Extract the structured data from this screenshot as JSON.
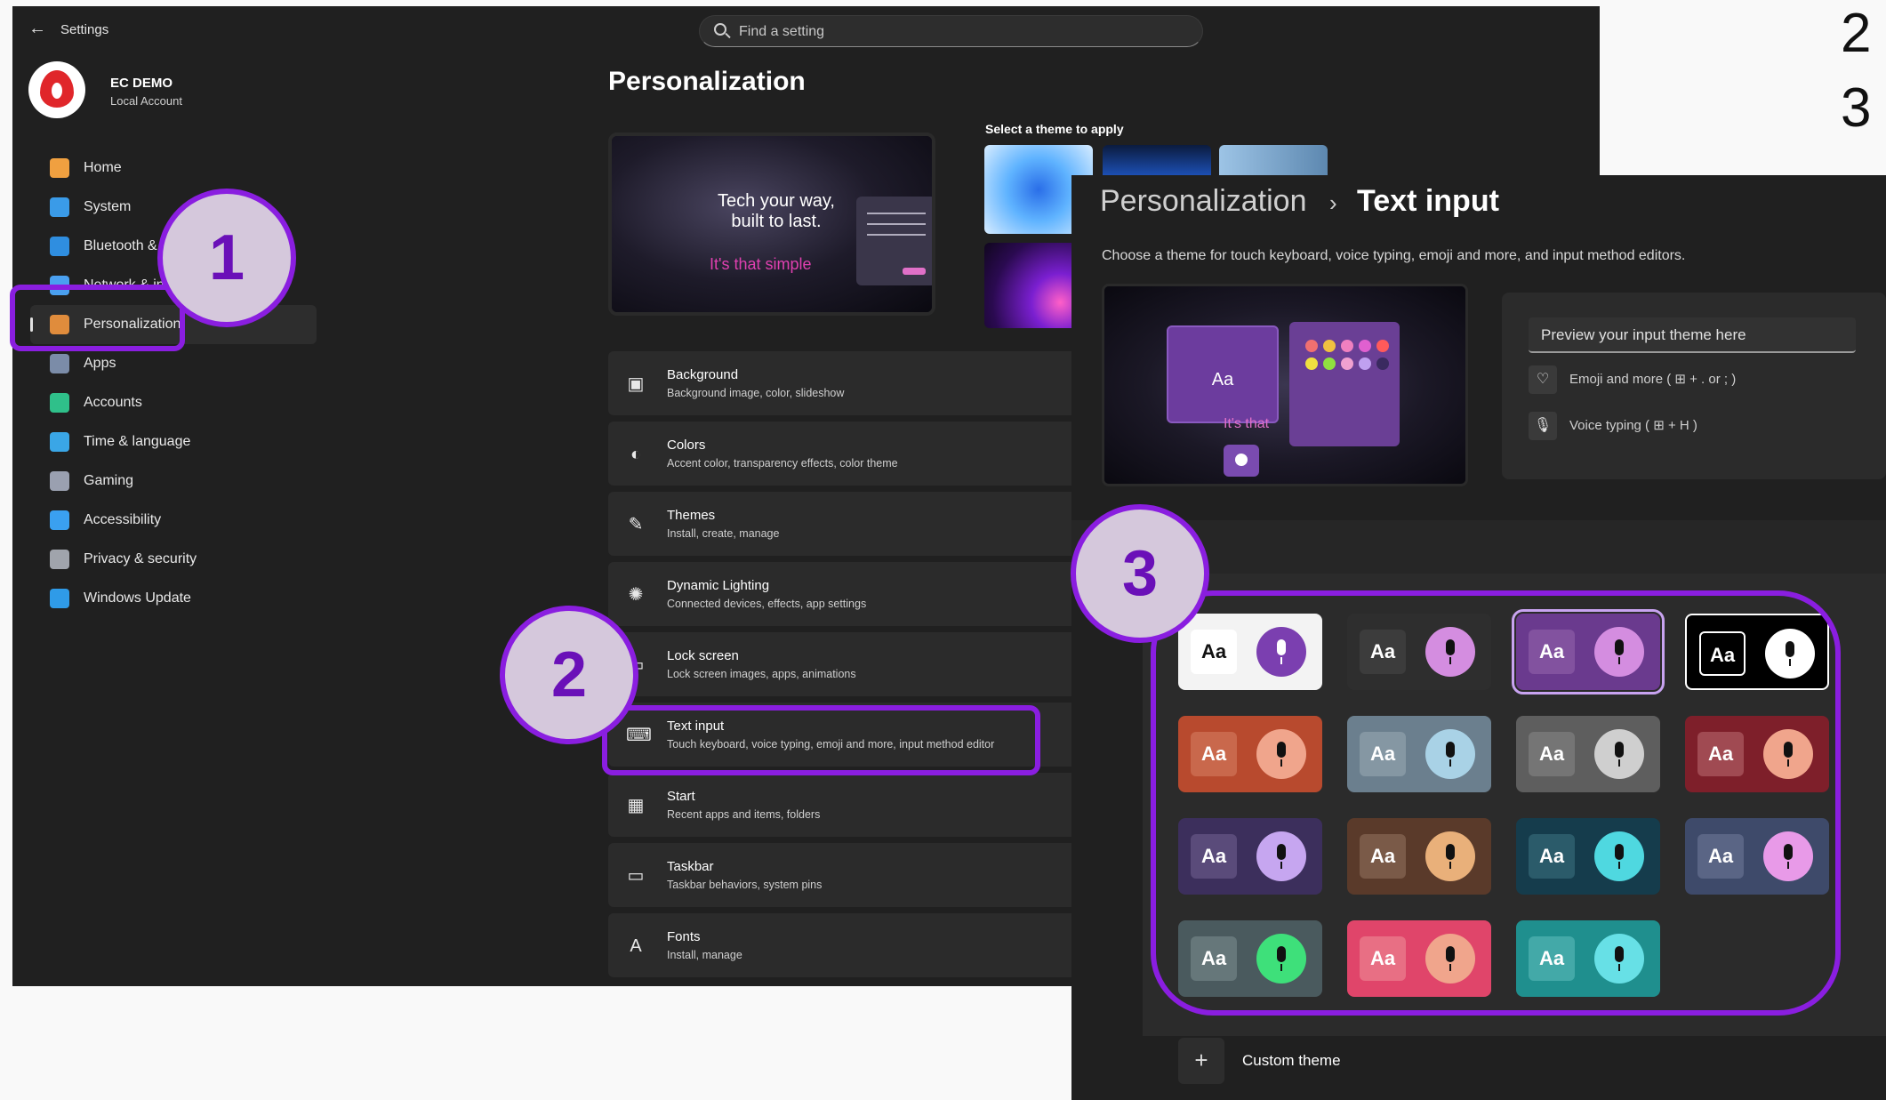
{
  "settings": {
    "app_title": "Settings",
    "search_placeholder": "Find a setting",
    "profile": {
      "name": "EC DEMO",
      "account_type": "Local Account"
    },
    "nav": [
      {
        "label": "Home",
        "icon": "home-icon",
        "color": "#f0a040",
        "active": false
      },
      {
        "label": "System",
        "icon": "system-icon",
        "color": "#3a9be8",
        "active": false
      },
      {
        "label": "Bluetooth & d",
        "icon": "bluetooth-icon",
        "color": "#2f8ee0",
        "active": false
      },
      {
        "label": "Network & int",
        "icon": "network-icon",
        "color": "#4aa0f0",
        "active": false
      },
      {
        "label": "Personalization",
        "icon": "brush-icon",
        "color": "#e08c3c",
        "active": true
      },
      {
        "label": "Apps",
        "icon": "apps-icon",
        "color": "#7b8ca8",
        "active": false
      },
      {
        "label": "Accounts",
        "icon": "accounts-icon",
        "color": "#2fc08a",
        "active": false
      },
      {
        "label": "Time & language",
        "icon": "globe-icon",
        "color": "#3aa6e6",
        "active": false
      },
      {
        "label": "Gaming",
        "icon": "gamepad-icon",
        "color": "#9aa0b0",
        "active": false
      },
      {
        "label": "Accessibility",
        "icon": "accessibility-icon",
        "color": "#3aa0f0",
        "active": false
      },
      {
        "label": "Privacy & security",
        "icon": "shield-icon",
        "color": "#a0a4ac",
        "active": false
      },
      {
        "label": "Windows Update",
        "icon": "update-icon",
        "color": "#2f9be8",
        "active": false
      }
    ],
    "page_title": "Personalization",
    "hero": {
      "line1": "Tech your way, built to last.",
      "line2": "It's that simple"
    },
    "themes_heading": "Select a theme to apply",
    "cards": [
      {
        "title": "Background",
        "subtitle": "Background image, color, slideshow",
        "icon": "image-icon",
        "glyph": "▣"
      },
      {
        "title": "Colors",
        "subtitle": "Accent color, transparency effects, color theme",
        "icon": "palette-icon",
        "glyph": "◐"
      },
      {
        "title": "Themes",
        "subtitle": "Install, create, manage",
        "icon": "brush-icon",
        "glyph": "✎"
      },
      {
        "title": "Dynamic Lighting",
        "subtitle": "Connected devices, effects, app settings",
        "icon": "lighting-icon",
        "glyph": "✺"
      },
      {
        "title": "Lock screen",
        "subtitle": "Lock screen images, apps, animations",
        "icon": "lock-screen-icon",
        "glyph": "▭"
      },
      {
        "title": "Text input",
        "subtitle": "Touch keyboard, voice typing, emoji and more, input method editor",
        "icon": "keyboard-icon",
        "glyph": "⌨"
      },
      {
        "title": "Start",
        "subtitle": "Recent apps and items, folders",
        "icon": "start-icon",
        "glyph": "▦"
      },
      {
        "title": "Taskbar",
        "subtitle": "Taskbar behaviors, system pins",
        "icon": "taskbar-icon",
        "glyph": "▭"
      },
      {
        "title": "Fonts",
        "subtitle": "Install, manage",
        "icon": "fonts-icon",
        "glyph": "A"
      }
    ]
  },
  "text_input": {
    "breadcrumb_parent": "Personalization",
    "breadcrumb_sep": "›",
    "breadcrumb_current": "Text input",
    "description": "Choose a theme for touch keyboard, voice typing, emoji and more, and input method editors.",
    "preview_input_placeholder": "Preview your input theme here",
    "preview_rows": [
      {
        "label": "Emoji and more ( ⊞ + . or ; )",
        "icon": "emoji-icon",
        "glyph": "♡"
      },
      {
        "label": "Voice typing ( ⊞ + H )",
        "icon": "microphone-icon",
        "glyph": "🎙"
      }
    ],
    "preview_text": "It's that",
    "preview_key": "Aa",
    "tile_label": "Aa",
    "themes": [
      {
        "name": "light",
        "bg": "#f3f3f3",
        "aa_bg": "#ffffff",
        "aa_fg": "#111111",
        "mic": "#7b3fb0",
        "mic_light": true,
        "selected": false
      },
      {
        "name": "dark",
        "bg": "#2e2e2e",
        "aa_bg": "#3c3c3c",
        "aa_fg": "#ffffff",
        "mic": "#d48de0",
        "mic_light": false,
        "selected": false
      },
      {
        "name": "purple",
        "bg": "#6a3a8e",
        "aa_bg": "#82529f",
        "aa_fg": "#ffffff",
        "mic": "#d48de0",
        "mic_light": false,
        "selected": true
      },
      {
        "name": "high-contrast",
        "bg": "#000000",
        "aa_bg": "#000000",
        "aa_fg": "#ffffff",
        "mic": "#ffffff",
        "mic_light": false,
        "selected": false
      },
      {
        "name": "red",
        "bg": "#b84a2e",
        "aa_bg": "#c9684c",
        "aa_fg": "#ffffff",
        "mic": "#f0a58c",
        "mic_light": false,
        "selected": false
      },
      {
        "name": "blue-gray",
        "bg": "#6b7f8e",
        "aa_bg": "#8597a3",
        "aa_fg": "#ffffff",
        "mic": "#a9d2e6",
        "mic_light": false,
        "selected": false
      },
      {
        "name": "gray",
        "bg": "#5e5e5e",
        "aa_bg": "#757575",
        "aa_fg": "#ffffff",
        "mic": "#cfcfcf",
        "mic_light": false,
        "selected": false
      },
      {
        "name": "crimson-wave",
        "bg": "#7e1f2a",
        "aa_bg": "#a04a52",
        "aa_fg": "#ffffff",
        "mic": "#f0a58c",
        "mic_light": false,
        "selected": false
      },
      {
        "name": "dusk-wave",
        "bg": "#3c2f5c",
        "aa_bg": "#5a4b7a",
        "aa_fg": "#ffffff",
        "mic": "#c6a6f0",
        "mic_light": false,
        "selected": false
      },
      {
        "name": "amber-wave",
        "bg": "#5a3a2a",
        "aa_bg": "#7a5a48",
        "aa_fg": "#ffffff",
        "mic": "#e9b07a",
        "mic_light": false,
        "selected": false
      },
      {
        "name": "teal-wave",
        "bg": "#153c4c",
        "aa_bg": "#2b5b6a",
        "aa_fg": "#ffffff",
        "mic": "#4fd8e0",
        "mic_light": false,
        "selected": false
      },
      {
        "name": "slate-orchid",
        "bg": "#3e4a6a",
        "aa_bg": "#5a6585",
        "aa_fg": "#ffffff",
        "mic": "#e89ae8",
        "mic_light": false,
        "selected": false
      },
      {
        "name": "green",
        "bg": "#4a5a5e",
        "aa_bg": "#66777a",
        "aa_fg": "#ffffff",
        "mic": "#3ee07a",
        "mic_light": false,
        "selected": false
      },
      {
        "name": "sunset",
        "bg": "#e0456a",
        "aa_bg": "#e86f84",
        "aa_fg": "#ffffff",
        "mic": "#f0a58c",
        "mic_light": false,
        "selected": false
      },
      {
        "name": "aqua",
        "bg": "#1f8f8e",
        "aa_bg": "#43a9a8",
        "aa_fg": "#ffffff",
        "mic": "#67e0e6",
        "mic_light": false,
        "selected": false
      }
    ],
    "custom_theme_label": "Custom theme",
    "custom_theme_glyph": "+"
  },
  "edge_numbers": [
    "2",
    "3"
  ],
  "badges": [
    "1",
    "2",
    "3"
  ],
  "accent_color": "#8a1ee0"
}
